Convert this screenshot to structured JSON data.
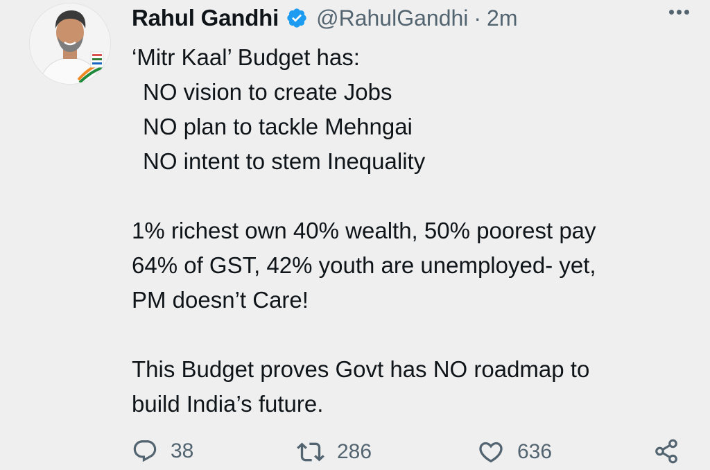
{
  "author": {
    "name": "Rahul Gandhi",
    "handle": "@RahulGandhi",
    "time": "2m",
    "verified": true,
    "avatar_icon": "profile-photo-icon"
  },
  "tweet": {
    "lines": [
      "‘Mitr Kaal’ Budget has:",
      "NO vision to create Jobs",
      "NO plan to tackle Mehngai",
      "NO intent to stem Inequality",
      "1% richest own 40% wealth, 50% poorest pay",
      "64% of GST, 42% youth are unemployed- yet,",
      "PM doesn’t Care!",
      "This Budget proves Govt has NO roadmap to",
      "build India’s future."
    ]
  },
  "actions": {
    "reply": {
      "count": "38",
      "icon": "reply-icon"
    },
    "retweet": {
      "count": "286",
      "icon": "retweet-icon"
    },
    "like": {
      "count": "636",
      "icon": "heart-icon"
    },
    "share": {
      "icon": "share-icon"
    }
  },
  "colors": {
    "background": "#efefef",
    "verified": "#1d9bf0",
    "secondary_text": "#536471",
    "primary_text": "#0f1419"
  }
}
